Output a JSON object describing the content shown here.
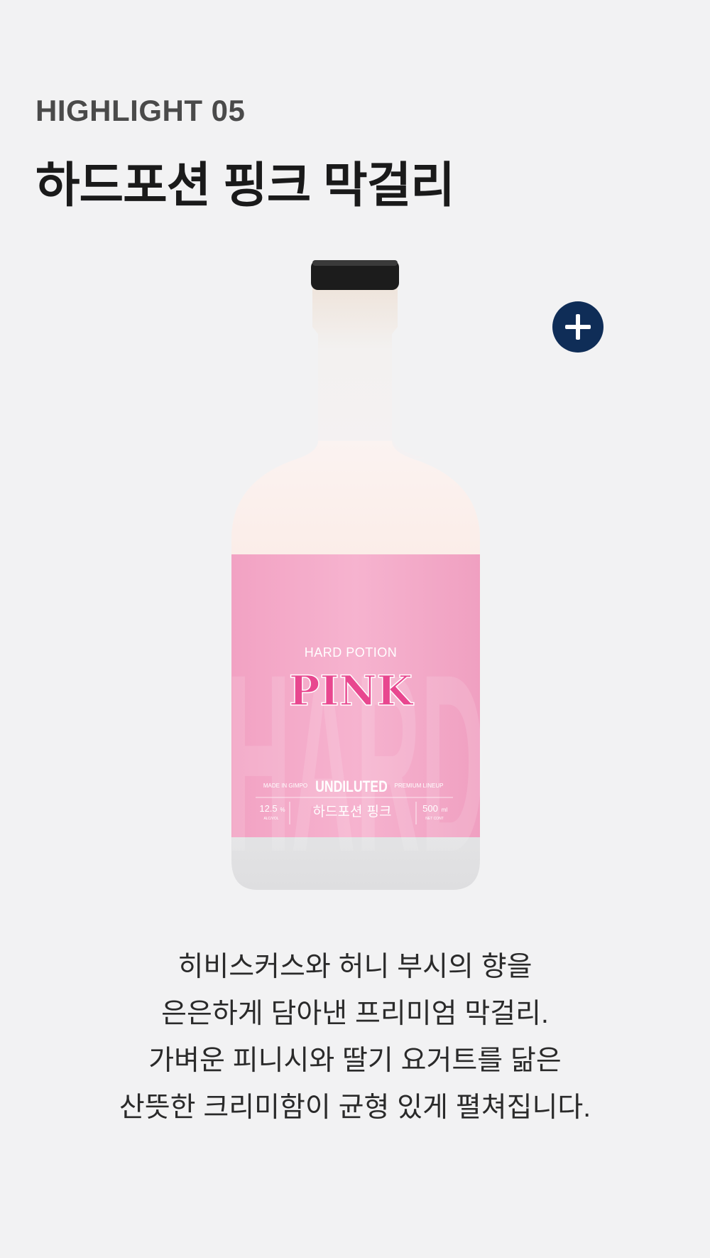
{
  "header": {
    "eyebrow": "HIGHLIGHT 05",
    "title": "하드포션 핑크 막걸리"
  },
  "product": {
    "image_icon": "bottle-image",
    "label": {
      "brand": "HARD POTION",
      "name": "PINK",
      "background_word": "HARD",
      "made_in": "MADE IN GIMPO",
      "type": "UNDILUTED",
      "lineup": "PREMIUM LINEUP",
      "alcohol_value": "12.5",
      "alcohol_unit": "%",
      "alcohol_caption": "ALC/VOL",
      "korean_name": "하드포션 핑크",
      "volume_value": "500",
      "volume_unit": "ml",
      "volume_caption": "NET CONT"
    },
    "colors": {
      "label_pink": "#f4a7c6",
      "pink_text": "#e8478f",
      "cap": "#1c1c1c",
      "plus_button": "#0f2d57"
    },
    "plus_button_icon": "plus-icon"
  },
  "description": {
    "lines": [
      "히비스커스와 허니 부시의 향을",
      "은은하게 담아낸 프리미엄 막걸리.",
      "가벼운 피니시와 딸기 요거트를 닮은",
      "산뜻한 크리미함이 균형 있게 펼쳐집니다."
    ]
  }
}
